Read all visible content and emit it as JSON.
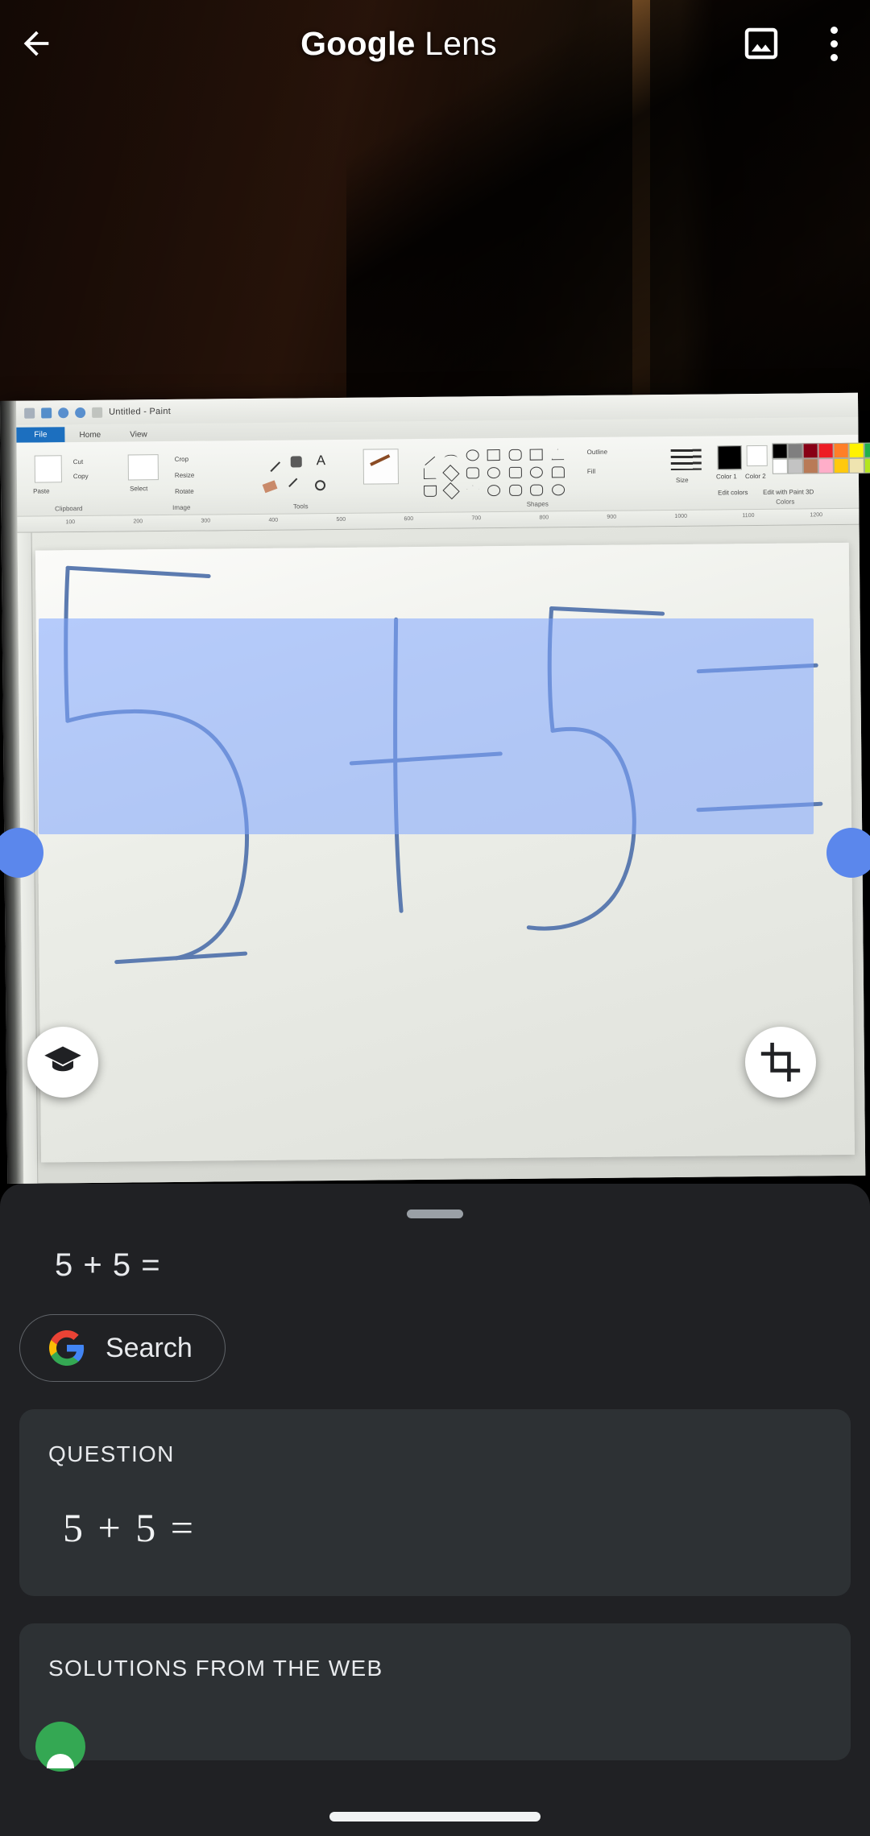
{
  "appbar": {
    "title_bold": "Google",
    "title_light": " Lens",
    "back_icon": "back-arrow-icon",
    "gallery_icon": "gallery-image-icon",
    "overflow_icon": "three-dot-menu-icon"
  },
  "viewport": {
    "fab_homework_icon": "graduation-cap-icon",
    "fab_crop_icon": "crop-icon",
    "selection_handle_color": "#5b87ec",
    "selection_overlay_color": "#80a6ff"
  },
  "photo": {
    "paint_window": {
      "title": "Untitled - Paint",
      "tabs": [
        "File",
        "Home",
        "View"
      ],
      "groups": [
        {
          "label": "Clipboard",
          "items": [
            "Paste",
            "Cut",
            "Copy"
          ]
        },
        {
          "label": "Image",
          "items": [
            "Select",
            "Crop",
            "Resize",
            "Rotate"
          ]
        },
        {
          "label": "Tools",
          "items": []
        },
        {
          "label": "Shapes",
          "items": [
            "Outline",
            "Fill"
          ]
        },
        {
          "label": "Size",
          "items": []
        },
        {
          "label": "Colors",
          "items": [
            "Color 1",
            "Color 2",
            "Edit colors",
            "Edit with Paint 3D"
          ]
        }
      ],
      "ruler_ticks": [
        "100",
        "200",
        "300",
        "400",
        "500",
        "600",
        "700",
        "800",
        "900",
        "1000",
        "1100",
        "1200"
      ],
      "palette_row1": [
        "#000000",
        "#7f7f7f",
        "#880015",
        "#ed1c24",
        "#ff7f27",
        "#fff200",
        "#22b14c",
        "#00a2e8",
        "#3f48cc",
        "#a349a4"
      ],
      "palette_row2": [
        "#ffffff",
        "#c3c3c3",
        "#b97a57",
        "#ffaec9",
        "#ffc90e",
        "#efe4b0",
        "#b5e61d",
        "#99d9ea",
        "#7092be",
        "#c8bfe7"
      ],
      "handwriting": "5 + 5 ="
    }
  },
  "sheet": {
    "drag_handle": "bottom-sheet-drag-handle",
    "ocr_text": "5 + 5 =",
    "search_button_label": "Search",
    "search_button_icon": "google-g-logo",
    "question_card": {
      "heading": "QUESTION",
      "expression": "5 + 5 ="
    },
    "solutions_card": {
      "heading": "SOLUTIONS FROM THE WEB"
    }
  },
  "system": {
    "nav_pill": "home-gesture-pill"
  },
  "colors": {
    "sheet_bg": "#202124",
    "card_bg": "#2d3134",
    "text_primary": "#e8eaed",
    "accent_blue": "#5b87ec",
    "green": "#34a853"
  }
}
